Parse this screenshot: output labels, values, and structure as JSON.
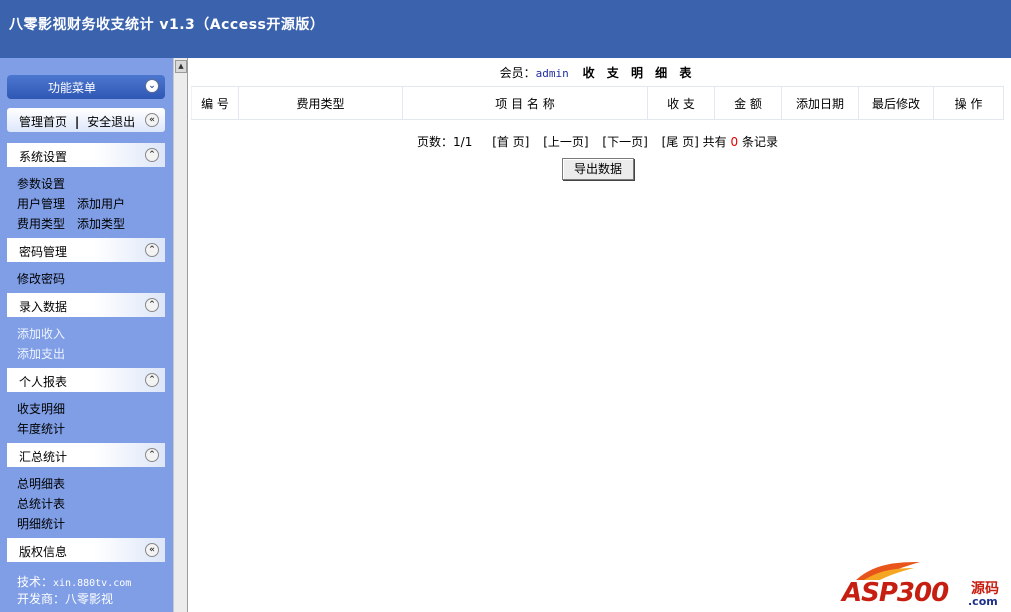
{
  "header": {
    "title": "八零影视财务收支统计 v1.3（Access开源版）"
  },
  "sidebar": {
    "menu_title": "功能菜单",
    "top_links": {
      "home": "管理首页",
      "separator": "|",
      "logout": "安全退出"
    },
    "sections": [
      {
        "title": "系统设置",
        "items": [
          "参数设置",
          "用户管理",
          "添加用户",
          "费用类型",
          "添加类型"
        ]
      },
      {
        "title": "密码管理",
        "items": [
          "修改密码"
        ]
      },
      {
        "title": "录入数据",
        "items": [
          "添加收入",
          "添加支出"
        ]
      },
      {
        "title": "个人报表",
        "items": [
          "收支明细",
          "年度统计"
        ]
      },
      {
        "title": "汇总统计",
        "items": [
          "总明细表",
          "总统计表",
          "明细统计"
        ]
      }
    ],
    "copyright": {
      "title": "版权信息",
      "tech_label": "技术：",
      "tech_value": "xin.880tv.com",
      "dev_label": "开发商：",
      "dev_value": "八零影视"
    }
  },
  "main": {
    "member_label": "会员：",
    "member_name": "admin",
    "table_title": "收 支 明 细 表",
    "columns": [
      "编 号",
      "费用类型",
      "项 目 名 称",
      "收 支",
      "金 额",
      "添加日期",
      "最后修改",
      "操 作"
    ],
    "pager": {
      "pages_label": "页数：",
      "pages_value": "1/1",
      "first": "[首 页]",
      "prev": "[上一页]",
      "next": "[下一页]",
      "last": "[尾 页]",
      "total_prefix": "共有",
      "total_count": "0",
      "total_suffix": "条记录"
    },
    "export_button": "导出数据"
  },
  "watermark": {
    "brand": "ASP300",
    "suffix": "源码",
    "domain": ".com"
  },
  "colors": {
    "header": "#3b63ad",
    "sidebar": "#7f9ee6",
    "count": "#e00000"
  }
}
